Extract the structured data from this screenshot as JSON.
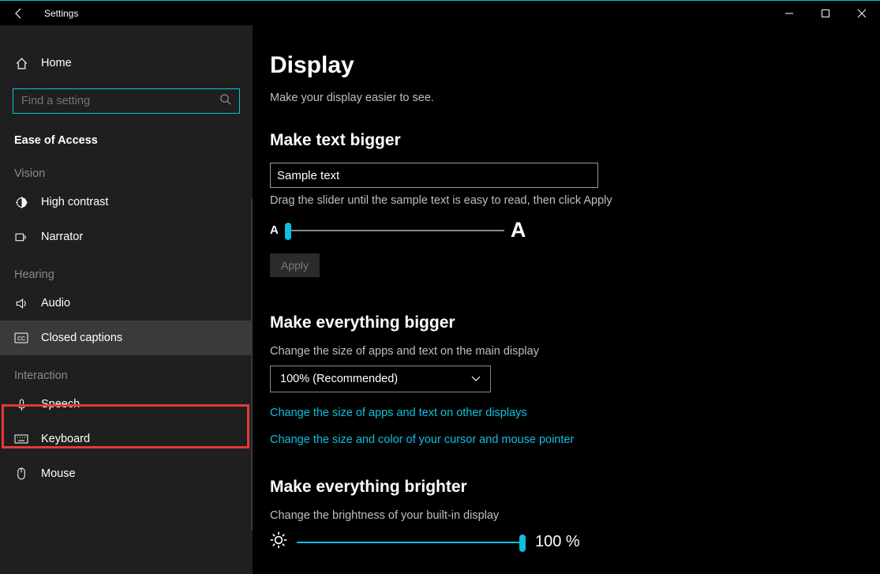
{
  "window": {
    "title": "Settings"
  },
  "sidebar": {
    "home_label": "Home",
    "search_placeholder": "Find a setting",
    "category_header": "Ease of Access",
    "sections": {
      "vision": "Vision",
      "hearing": "Hearing",
      "interaction": "Interaction"
    },
    "items": {
      "high_contrast": "High contrast",
      "narrator": "Narrator",
      "audio": "Audio",
      "closed_captions": "Closed captions",
      "speech": "Speech",
      "keyboard": "Keyboard",
      "mouse": "Mouse"
    }
  },
  "main": {
    "title": "Display",
    "subtitle": "Make your display easier to see.",
    "text_bigger": {
      "heading": "Make text bigger",
      "sample": "Sample text",
      "hint": "Drag the slider until the sample text is easy to read, then click Apply",
      "small_a": "A",
      "big_a": "A",
      "apply": "Apply",
      "slider_pos_pct": 0
    },
    "everything_bigger": {
      "heading": "Make everything bigger",
      "label": "Change the size of apps and text on the main display",
      "dropdown_value": "100% (Recommended)",
      "link1": "Change the size of apps and text on other displays",
      "link2": "Change the size and color of your cursor and mouse pointer"
    },
    "brighter": {
      "heading": "Make everything brighter",
      "label": "Change the brightness of your built-in display",
      "value_text": "100 %",
      "slider_pos_pct": 100
    }
  }
}
